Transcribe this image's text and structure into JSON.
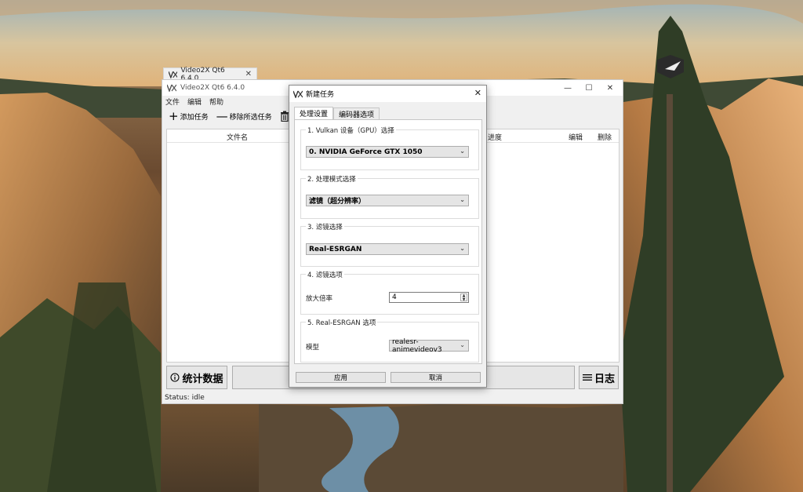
{
  "background_tab": {
    "title": "Video2X Qt6 6.4.0",
    "close": "✕"
  },
  "main_window": {
    "title": "Video2X Qt6 6.4.0",
    "controls": {
      "minimize": "—",
      "maximize": "☐",
      "close": "✕"
    },
    "menu": [
      "文件",
      "编辑",
      "帮助"
    ],
    "toolbar": {
      "add_task": "添加任务",
      "remove_selected": "移除所选任务",
      "clear": "清"
    },
    "table_headers": {
      "filename": "文件名",
      "progress": "进度",
      "edit": "编辑",
      "delete": "删除"
    },
    "stats_button": "统计数据",
    "log_button": "日志",
    "status": "Status: idle"
  },
  "dialog": {
    "title": "新建任务",
    "close": "✕",
    "tabs": [
      "处理设置",
      "编码器选项"
    ],
    "groups": {
      "vulkan": {
        "title": "1. Vulkan 设备（GPU）选择",
        "value": "0. NVIDIA GeForce GTX 1050"
      },
      "mode": {
        "title": "2. 处理模式选择",
        "value": "滤镜（超分辨率）"
      },
      "filter": {
        "title": "3. 滤镜选择",
        "value": "Real-ESRGAN"
      },
      "filter_options": {
        "title": "4. 滤镜选项",
        "scale_label": "放大倍率",
        "scale_value": "4"
      },
      "realesrgan": {
        "title": "5. Real-ESRGAN 选项",
        "model_label": "模型",
        "model_value": "realesr-animevideov3"
      }
    },
    "apply": "应用",
    "cancel": "取消"
  },
  "icons": {
    "app": "video2x-logo-icon",
    "add": "plus-icon",
    "remove": "minus-icon",
    "clear": "trash-icon",
    "stats": "info-icon",
    "log": "list-icon",
    "chevron": "chevron-down-icon",
    "spin": "spin-arrows-icon"
  }
}
